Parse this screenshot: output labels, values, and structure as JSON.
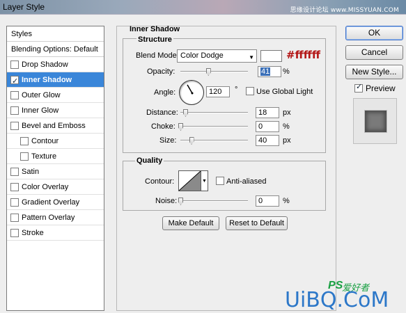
{
  "window": {
    "title": "Layer Style",
    "watermark": "思缘设计论坛 www.MISSYUAN.COM"
  },
  "styles_panel": {
    "header": "Styles",
    "blending_options": "Blending Options: Default",
    "items": [
      {
        "label": "Drop Shadow",
        "checked": false,
        "selected": false,
        "indent": false
      },
      {
        "label": "Inner Shadow",
        "checked": true,
        "selected": true,
        "indent": false
      },
      {
        "label": "Outer Glow",
        "checked": false,
        "selected": false,
        "indent": false
      },
      {
        "label": "Inner Glow",
        "checked": false,
        "selected": false,
        "indent": false
      },
      {
        "label": "Bevel and Emboss",
        "checked": false,
        "selected": false,
        "indent": false
      },
      {
        "label": "Contour",
        "checked": false,
        "selected": false,
        "indent": true
      },
      {
        "label": "Texture",
        "checked": false,
        "selected": false,
        "indent": true
      },
      {
        "label": "Satin",
        "checked": false,
        "selected": false,
        "indent": false
      },
      {
        "label": "Color Overlay",
        "checked": false,
        "selected": false,
        "indent": false
      },
      {
        "label": "Gradient Overlay",
        "checked": false,
        "selected": false,
        "indent": false
      },
      {
        "label": "Pattern Overlay",
        "checked": false,
        "selected": false,
        "indent": false
      },
      {
        "label": "Stroke",
        "checked": false,
        "selected": false,
        "indent": false
      }
    ]
  },
  "inner_shadow": {
    "title": "Inner Shadow",
    "structure": {
      "title": "Structure",
      "blend_mode_label": "Blend Mode:",
      "blend_mode_value": "Color Dodge",
      "color_annotation": "#ffffff",
      "opacity_label": "Opacity:",
      "opacity_value": "41",
      "opacity_unit": "%",
      "opacity_percent": 41,
      "angle_label": "Angle:",
      "angle_value": "120",
      "angle_degrees": 120,
      "angle_unit": "°",
      "use_global_light_label": "Use Global Light",
      "use_global_light": false,
      "distance_label": "Distance:",
      "distance_value": "18",
      "distance_unit": "px",
      "distance_number": 18,
      "choke_label": "Choke:",
      "choke_value": "0",
      "choke_unit": "%",
      "choke_number": 0,
      "size_label": "Size:",
      "size_value": "40",
      "size_unit": "px",
      "size_number": 40
    },
    "quality": {
      "title": "Quality",
      "contour_label": "Contour:",
      "anti_aliased_label": "Anti-aliased",
      "anti_aliased": false,
      "noise_label": "Noise:",
      "noise_value": "0",
      "noise_unit": "%",
      "noise_number": 0
    },
    "make_default_label": "Make Default",
    "reset_default_label": "Reset to Default"
  },
  "actions": {
    "ok_label": "OK",
    "cancel_label": "Cancel",
    "new_style_label": "New Style...",
    "preview_label": "Preview",
    "preview_checked": true
  },
  "logo": {
    "ps": "PS",
    "cn": "爱好者",
    "site": "UiBQ.CoM"
  }
}
